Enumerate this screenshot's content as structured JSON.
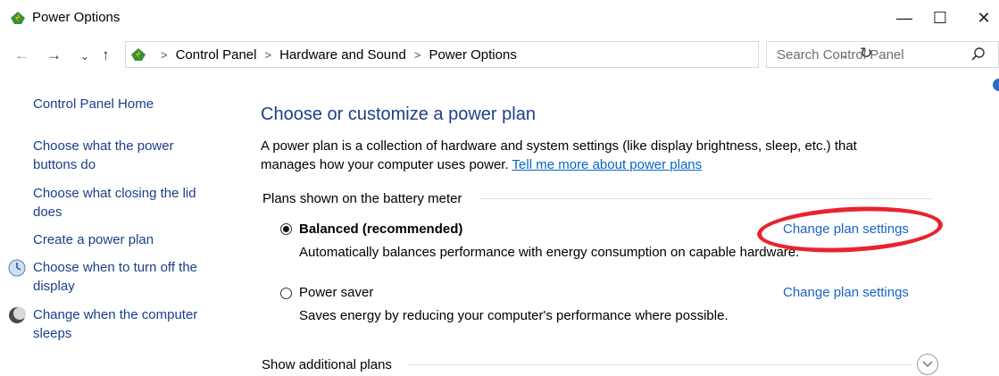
{
  "window": {
    "title": "Power Options",
    "minimize": "—",
    "maximize": "☐",
    "close": "✕"
  },
  "nav": {
    "back": "←",
    "forward": "→",
    "recent": "⌄",
    "up": "↑"
  },
  "address": {
    "crumbs": [
      "Control Panel",
      "Hardware and Sound",
      "Power Options"
    ],
    "separator": ">",
    "dropdown": "⌄",
    "refresh": "↻"
  },
  "search": {
    "placeholder": "Search Control Panel"
  },
  "sidebar": {
    "items": [
      {
        "label": "Control Panel Home"
      },
      {
        "label": "Choose what the power buttons do"
      },
      {
        "label": "Choose what closing the lid does"
      },
      {
        "label": "Create a power plan"
      },
      {
        "label": "Choose when to turn off the display",
        "icon": "display-icon"
      },
      {
        "label": "Change when the computer sleeps",
        "icon": "moon-icon"
      }
    ]
  },
  "main": {
    "heading": "Choose or customize a power plan",
    "description": "A power plan is a collection of hardware and system settings (like display brightness, sleep, etc.) that manages how your computer uses power. ",
    "learn_more": "Tell me more about power plans",
    "group_label": "Plans shown on the battery meter",
    "plans": [
      {
        "name": "Balanced (recommended)",
        "selected": true,
        "description": "Automatically balances performance with energy consumption on capable hardware.",
        "link": "Change plan settings"
      },
      {
        "name": "Power saver",
        "selected": false,
        "description": "Saves energy by reducing your computer's performance where possible.",
        "link": "Change plan settings"
      }
    ],
    "show_additional": "Show additional plans"
  },
  "colors": {
    "link": "#1a63c5",
    "heading": "#1e3f87",
    "annotation": "#e8232f"
  }
}
